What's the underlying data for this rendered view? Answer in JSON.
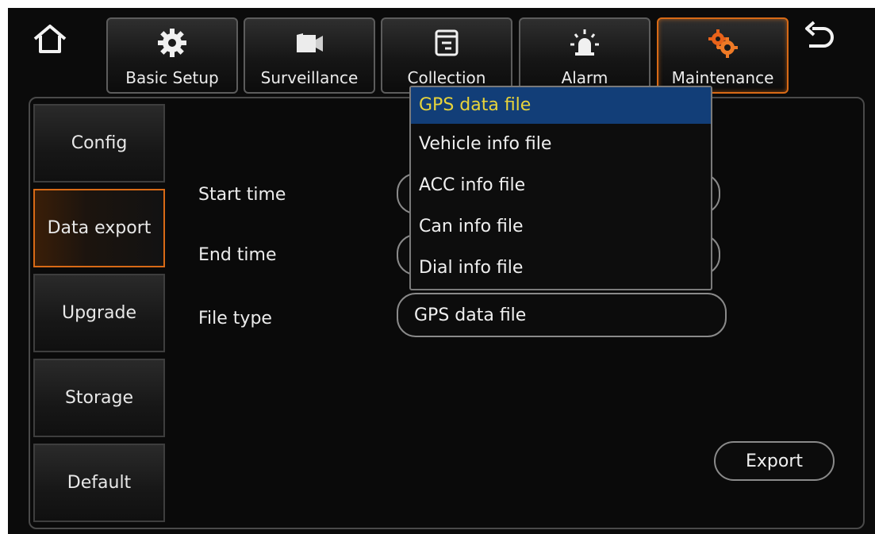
{
  "nav": {
    "tabs": [
      {
        "label": "Basic Setup",
        "icon": "gear-icon"
      },
      {
        "label": "Surveillance",
        "icon": "camera-icon"
      },
      {
        "label": "Collection",
        "icon": "document-icon"
      },
      {
        "label": "Alarm",
        "icon": "alarm-light-icon"
      },
      {
        "label": "Maintenance",
        "icon": "maintenance-gears-icon"
      }
    ],
    "active_tab": "Maintenance",
    "home_icon": "home-icon",
    "back_icon": "back-arrow-icon"
  },
  "sidebar": {
    "items": [
      {
        "label": "Config"
      },
      {
        "label": "Data export"
      },
      {
        "label": "Upgrade"
      },
      {
        "label": "Storage"
      },
      {
        "label": "Default"
      }
    ],
    "active": "Data export"
  },
  "form": {
    "start_time_label": "Start time",
    "end_time_label": "End time",
    "file_type_label": "File type",
    "file_type_value": "GPS data file"
  },
  "dropdown": {
    "options": [
      "GPS data file",
      "Vehicle info file",
      "ACC info file",
      "Can info file",
      "Dial info file"
    ],
    "selected": "GPS data file"
  },
  "export_label": "Export",
  "colors": {
    "accent_orange": "#d86a16",
    "selection_blue": "#123e78",
    "selection_text": "#e8d43a",
    "background": "#0b0b0b"
  }
}
